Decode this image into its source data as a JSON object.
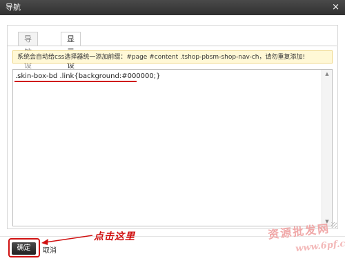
{
  "window": {
    "title": "导航",
    "close_symbol": "×"
  },
  "tabs": [
    {
      "label": "导航设置",
      "active": false
    },
    {
      "label": "显示设置",
      "active": true
    }
  ],
  "notice": {
    "text": "系统会自动给css选择器统一添加前缀：#page #content .tshop-pbsm-shop-nav-ch，请勿重复添加!"
  },
  "editor": {
    "value": ".skin-box-bd .link{background:#000000;}"
  },
  "buttons": {
    "ok_label": "确定",
    "cancel_label": "取消"
  },
  "annotation": {
    "text": "点击这里",
    "color": "#d01010"
  },
  "watermark": {
    "text": "资源批发网",
    "url": "www.6pf.cn"
  },
  "colors": {
    "titlebar": "#333333",
    "notice_bg": "#fff8d6",
    "annotation": "#d01010"
  }
}
